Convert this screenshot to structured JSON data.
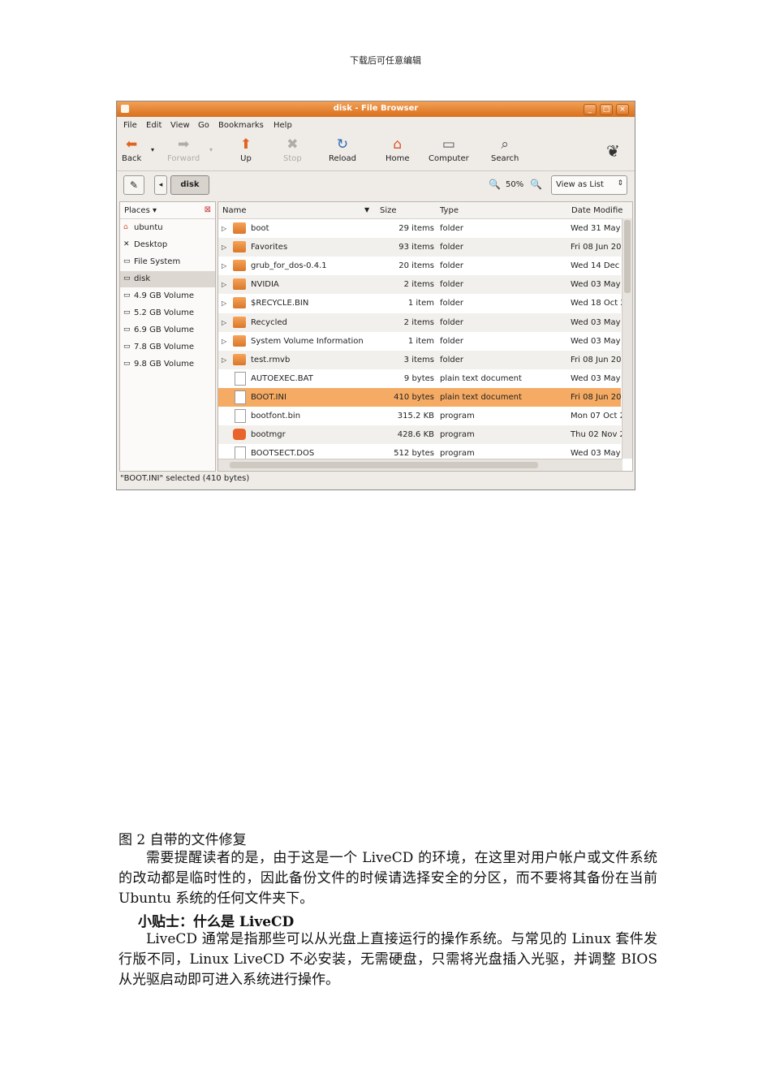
{
  "header_note": "下载后可任意编辑",
  "window": {
    "title": "disk - File Browser",
    "buttons": [
      "_",
      "□",
      "×"
    ],
    "menu": [
      "File",
      "Edit",
      "View",
      "Go",
      "Bookmarks",
      "Help"
    ],
    "toolbar": [
      {
        "label": "Back",
        "icon": "⬅"
      },
      {
        "label": "Forward",
        "icon": "➡"
      },
      {
        "label": "Up",
        "icon": "⬆"
      },
      {
        "label": "Stop",
        "icon": "✖"
      },
      {
        "label": "Reload",
        "icon": "↻"
      },
      {
        "label": "Home",
        "icon": "⌂"
      },
      {
        "label": "Computer",
        "icon": "▭"
      },
      {
        "label": "Search",
        "icon": "⌕"
      }
    ],
    "location": {
      "crumb": "disk",
      "zoom": "50%",
      "view_mode": "View as List"
    },
    "places": {
      "header": "Places ▾",
      "items": [
        "ubuntu",
        "Desktop",
        "File System",
        "disk",
        "4.9 GB Volume",
        "5.2 GB Volume",
        "6.9 GB Volume",
        "7.8 GB Volume",
        "9.8 GB Volume"
      ],
      "selected": "disk"
    },
    "columns": {
      "name": "Name",
      "size": "Size",
      "type": "Type",
      "date": "Date Modifie"
    },
    "files": [
      {
        "name": "boot",
        "size": "29 items",
        "type": "folder",
        "date": "Wed 31 May",
        "kind": "folder"
      },
      {
        "name": "Favorites",
        "size": "93 items",
        "type": "folder",
        "date": "Fri 08 Jun 20",
        "kind": "folder"
      },
      {
        "name": "grub_for_dos-0.4.1",
        "size": "20 items",
        "type": "folder",
        "date": "Wed 14 Dec",
        "kind": "folder"
      },
      {
        "name": "NVIDIA",
        "size": "2 items",
        "type": "folder",
        "date": "Wed 03 May",
        "kind": "folder"
      },
      {
        "name": "$RECYCLE.BIN",
        "size": "1 item",
        "type": "folder",
        "date": "Wed 18 Oct 2",
        "kind": "folder"
      },
      {
        "name": "Recycled",
        "size": "2 items",
        "type": "folder",
        "date": "Wed 03 May",
        "kind": "folder"
      },
      {
        "name": "System Volume Information",
        "size": "1 item",
        "type": "folder",
        "date": "Wed 03 May",
        "kind": "folder"
      },
      {
        "name": "test.rmvb",
        "size": "3 items",
        "type": "folder",
        "date": "Fri 08 Jun 20",
        "kind": "folder"
      },
      {
        "name": "AUTOEXEC.BAT",
        "size": "9 bytes",
        "type": "plain text document",
        "date": "Wed 03 May",
        "kind": "doc"
      },
      {
        "name": "BOOT.INI",
        "size": "410 bytes",
        "type": "plain text document",
        "date": "Fri 08 Jun 20",
        "kind": "doc"
      },
      {
        "name": "bootfont.bin",
        "size": "315.2 KB",
        "type": "program",
        "date": "Mon 07 Oct 2",
        "kind": "doc"
      },
      {
        "name": "bootmgr",
        "size": "428.6 KB",
        "type": "program",
        "date": "Thu 02 Nov 2",
        "kind": "prog"
      },
      {
        "name": "BOOTSECT.DOS",
        "size": "512 bytes",
        "type": "program",
        "date": "Wed 03 May",
        "kind": "doc"
      }
    ],
    "selected_file": "BOOT.INI",
    "status": "\"BOOT.INI\" selected (410 bytes)"
  },
  "doc": {
    "caption": "图 2 自带的文件修复",
    "para1": "需要提醒读者的是，由于这是一个 LiveCD 的环境，在这里对用户帐户或文件系统的改动都是临时性的，因此备份文件的时候请选择安全的分区，而不要将其备份在当前 Ubuntu 系统的任何文件夹下。",
    "tip_title": "小贴士：什么是 LiveCD",
    "para2": "LiveCD 通常是指那些可以从光盘上直接运行的操作系统。与常见的 Linux 套件发行版不同，Linux LiveCD 不必安装，无需硬盘，只需将光盘插入光驱，并调整 BIOS 从光驱启动即可进入系统进行操作。"
  }
}
